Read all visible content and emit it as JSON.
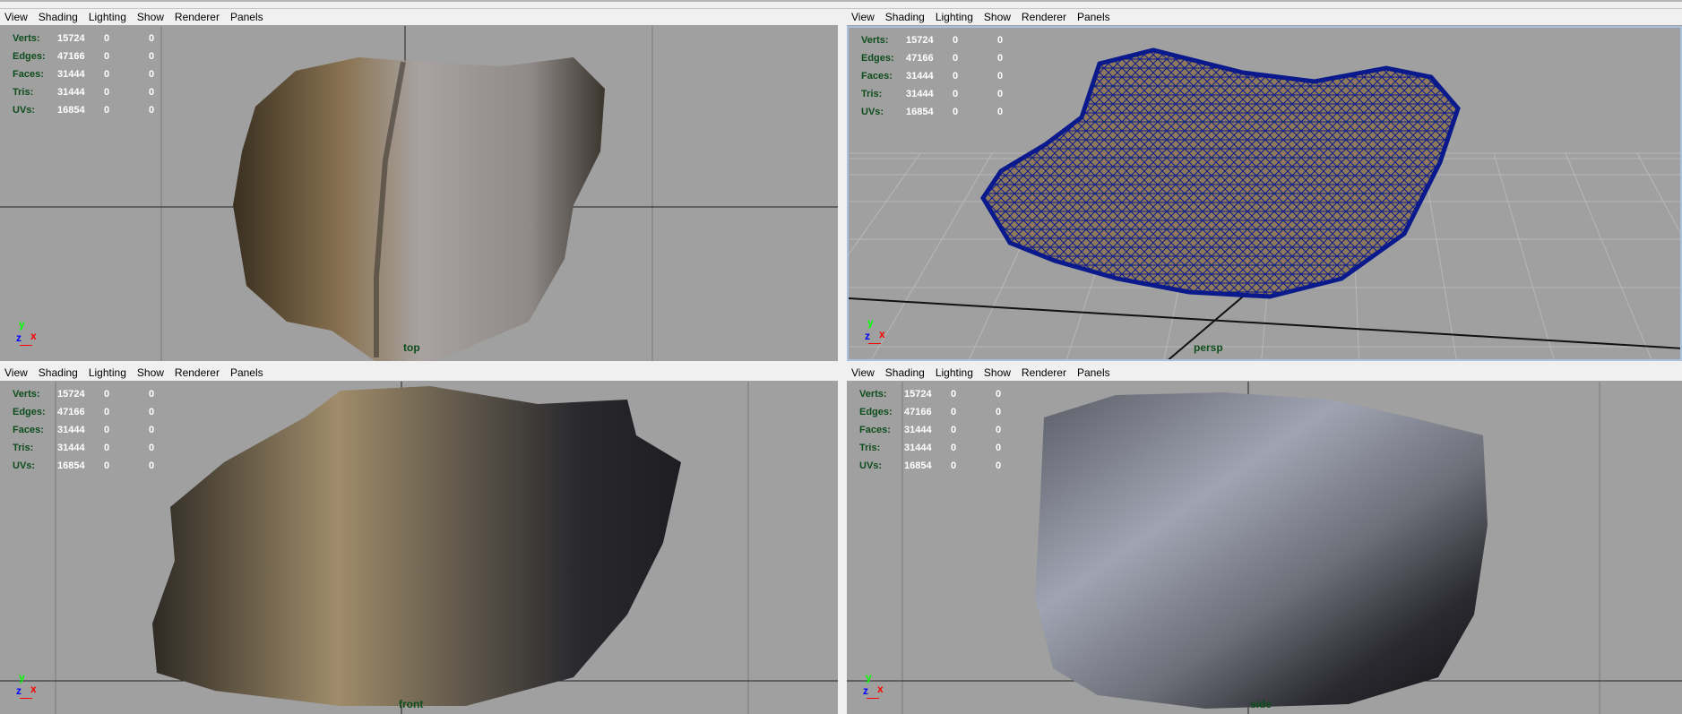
{
  "menu": [
    "View",
    "Shading",
    "Lighting",
    "Show",
    "Renderer",
    "Panels"
  ],
  "stats": [
    {
      "label": "Verts:",
      "value": "15724",
      "c1": "0",
      "c2": "0"
    },
    {
      "label": "Edges:",
      "value": "47166",
      "c1": "0",
      "c2": "0"
    },
    {
      "label": "Faces:",
      "value": "31444",
      "c1": "0",
      "c2": "0"
    },
    {
      "label": "Tris:",
      "value": "31444",
      "c1": "0",
      "c2": "0"
    },
    {
      "label": "UVs:",
      "value": "16854",
      "c1": "0",
      "c2": "0"
    }
  ],
  "axis": {
    "x": "x",
    "y": "y",
    "z": "z"
  },
  "panels": [
    {
      "camera": "top"
    },
    {
      "camera": "persp"
    },
    {
      "camera": "front"
    },
    {
      "camera": "side"
    }
  ],
  "colors": {
    "viewport": "#a0a0a0",
    "wireframe": "#0a1a8c",
    "stat_label": "#0e4d1c",
    "active_border": "#a6c2dc"
  }
}
